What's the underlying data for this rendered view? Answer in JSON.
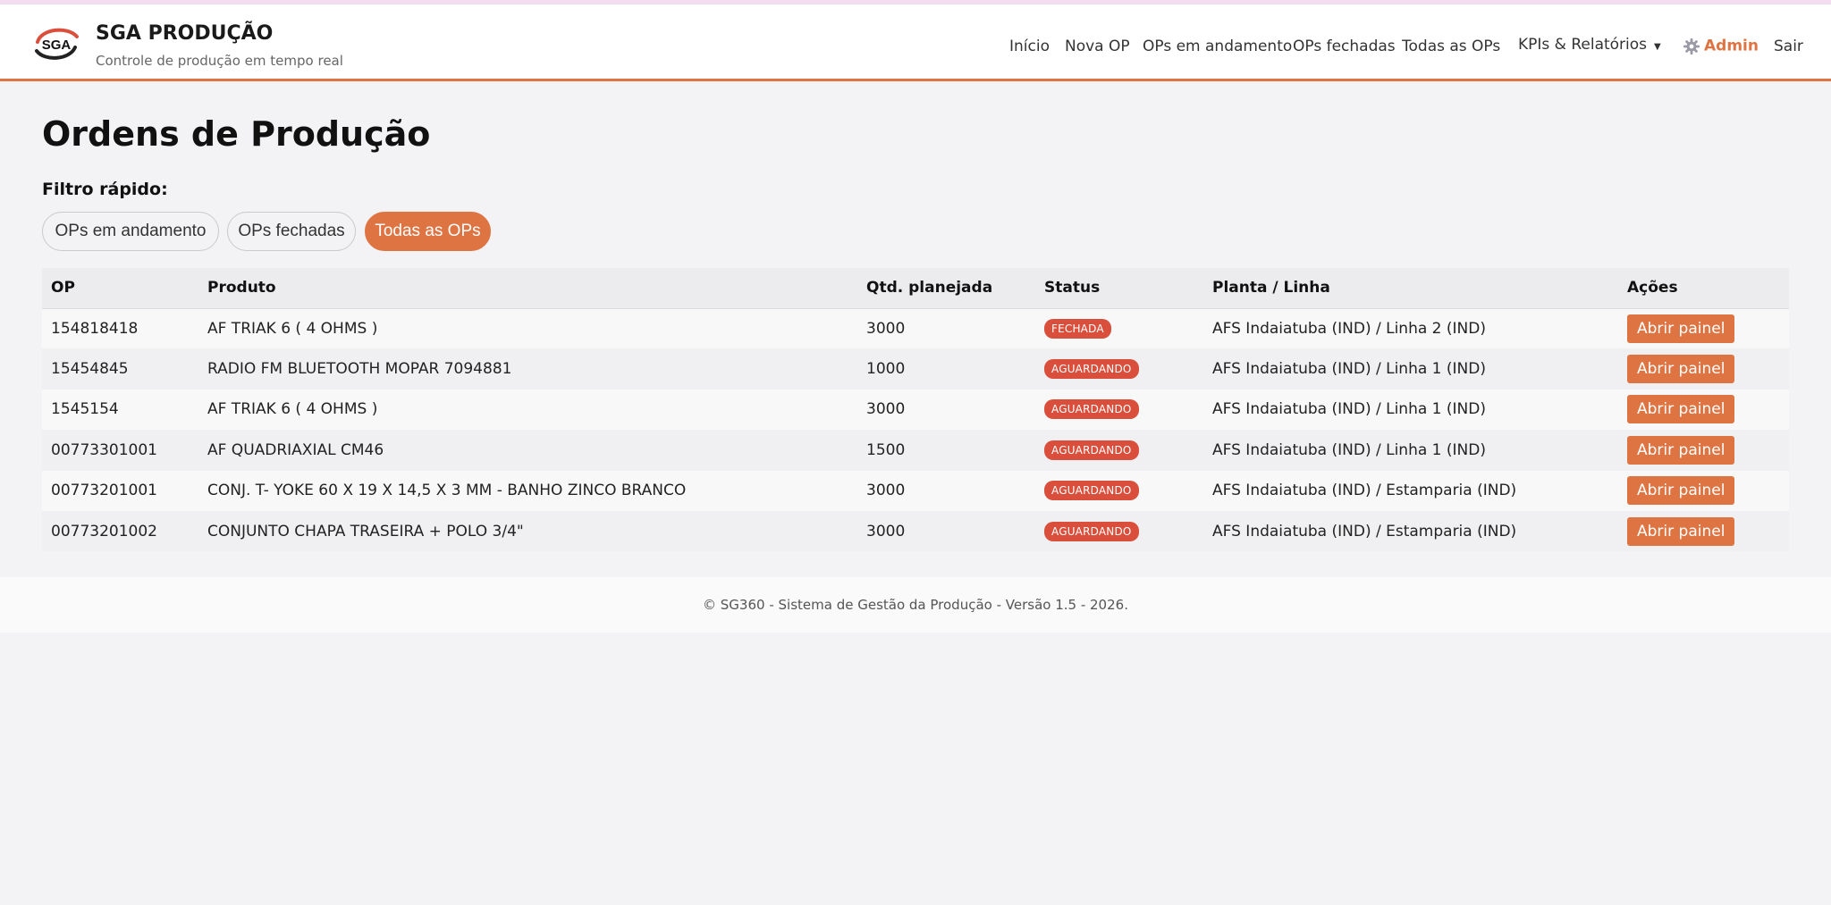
{
  "header": {
    "brand_title": "SGA PRODUÇÃO",
    "brand_subtitle": "Controle de produção em tempo real",
    "logo_text": "SGA",
    "nav": [
      {
        "label": "Início"
      },
      {
        "label": "Nova OP"
      },
      {
        "label": "OPs em andamento"
      },
      {
        "label": "OPs fechadas"
      },
      {
        "label": "Todas as OPs"
      },
      {
        "label": "KPIs & Relatórios"
      }
    ],
    "admin_label": "Admin",
    "logout_label": "Sair"
  },
  "main": {
    "title": "Ordens de Produção",
    "filter_label": "Filtro rápido:",
    "filters": [
      {
        "label": "OPs em andamento",
        "active": false
      },
      {
        "label": "OPs fechadas",
        "active": false
      },
      {
        "label": "Todas as OPs",
        "active": true
      }
    ],
    "table": {
      "columns": [
        "OP",
        "Produto",
        "Qtd. planejada",
        "Status",
        "Planta / Linha",
        "Ações"
      ],
      "rows": [
        {
          "op": "154818418",
          "produto": "AF TRIAK 6 ( 4 OHMS )",
          "qtd": "3000",
          "status": "FECHADA",
          "planta": "AFS Indaiatuba (IND) / Linha 2 (IND)",
          "acao": "Abrir painel"
        },
        {
          "op": "15454845",
          "produto": "RADIO FM BLUETOOTH MOPAR 7094881",
          "qtd": "1000",
          "status": "AGUARDANDO",
          "planta": "AFS Indaiatuba (IND) / Linha 1 (IND)",
          "acao": "Abrir painel"
        },
        {
          "op": "1545154",
          "produto": "AF TRIAK 6 ( 4 OHMS )",
          "qtd": "3000",
          "status": "AGUARDANDO",
          "planta": "AFS Indaiatuba (IND) / Linha 1 (IND)",
          "acao": "Abrir painel"
        },
        {
          "op": "00773301001",
          "produto": "AF QUADRIAXIAL CM46",
          "qtd": "1500",
          "status": "AGUARDANDO",
          "planta": "AFS Indaiatuba (IND) / Linha 1 (IND)",
          "acao": "Abrir painel"
        },
        {
          "op": "00773201001",
          "produto": "CONJ. T- YOKE 60 X 19 X 14,5 X 3 MM - BANHO ZINCO BRANCO",
          "qtd": "3000",
          "status": "AGUARDANDO",
          "planta": "AFS Indaiatuba (IND) / Estamparia (IND)",
          "acao": "Abrir painel"
        },
        {
          "op": "00773201002",
          "produto": "CONJUNTO CHAPA TRASEIRA + POLO 3/4\"",
          "qtd": "3000",
          "status": "AGUARDANDO",
          "planta": "AFS Indaiatuba (IND) / Estamparia (IND)",
          "acao": "Abrir painel"
        }
      ]
    }
  },
  "footer": {
    "text": "© SG360 - Sistema de Gestão da Produção - Versão 1.5 - 2026."
  },
  "colors": {
    "accent": "#df7443",
    "badge": "#d94f3c"
  }
}
